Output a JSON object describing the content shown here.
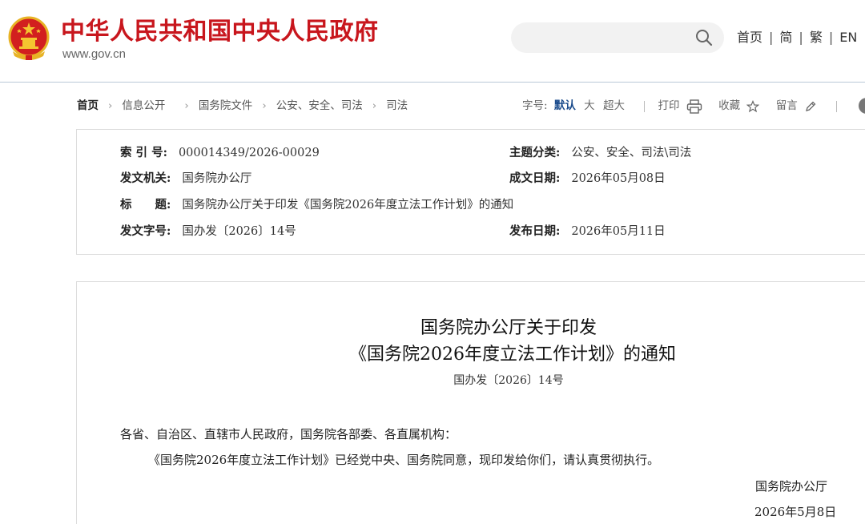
{
  "header": {
    "site_name": "中华人民共和国中央人民政府",
    "domain": "www.gov.cn",
    "nav": [
      "首页",
      "简",
      "繁",
      "EN"
    ],
    "search_placeholder": "",
    "brand_color": "#c8161d"
  },
  "breadcrumb": [
    "首页",
    "信息公开",
    "国务院文件",
    "公安、安全、司法",
    "司法"
  ],
  "tools": {
    "font_label": "字号:",
    "font_default": "默认",
    "font_large": "大",
    "font_xlarge": "超大",
    "print": "打印",
    "favorite": "收藏",
    "comment": "留言"
  },
  "meta": {
    "index_label": "索 引 号:",
    "index_value": "000014349/2026-00029",
    "topic_label": "主题分类:",
    "topic_value": "公安、安全、司法\\司法",
    "issuer_label": "发文机关:",
    "issuer_value": "国务院办公厅",
    "written_label": "成文日期:",
    "written_value": "2026年05月08日",
    "title_label": "标　　题:",
    "title_value": "国务院办公厅关于印发《国务院2026年度立法工作计划》的通知",
    "docno_label": "发文字号:",
    "docno_value": "国办发〔2026〕14号",
    "published_label": "发布日期:",
    "published_value": "2026年05月11日"
  },
  "document": {
    "title_line1": "国务院办公厅关于印发",
    "title_line2": "《国务院2026年度立法工作计划》的通知",
    "doc_number": "国办发〔2026〕14号",
    "salutation": "各省、自治区、直辖市人民政府，国务院各部委、各直属机构：",
    "body": "《国务院2026年度立法工作计划》已经党中央、国务院同意，现印发给你们，请认真贯彻执行。",
    "signature": "国务院办公厅",
    "date": "2026年5月8日"
  }
}
